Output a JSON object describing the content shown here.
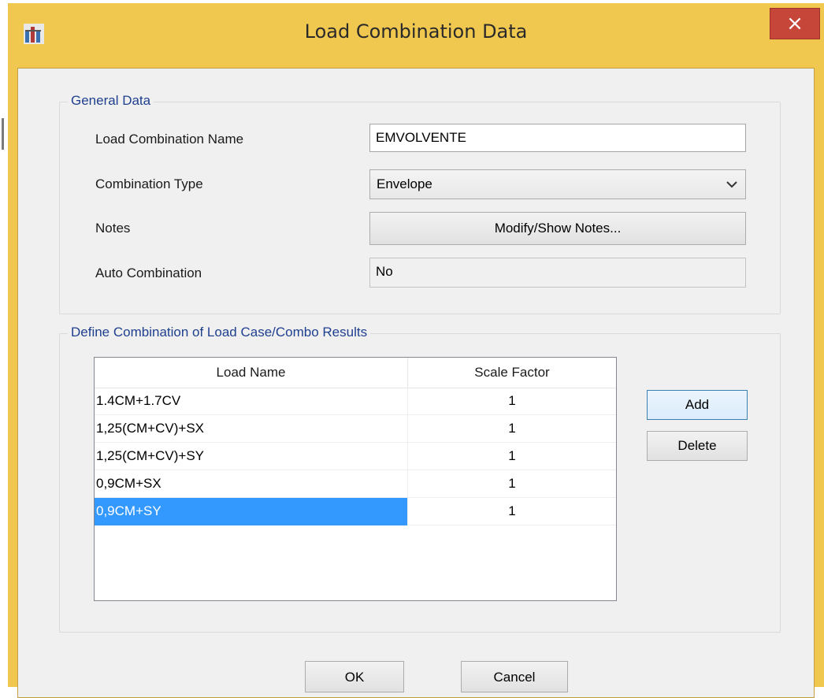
{
  "window": {
    "title": "Load Combination Data",
    "close_symbol": "×"
  },
  "general": {
    "legend": "General Data",
    "name_label": "Load Combination Name",
    "name_value": "EMVOLVENTE",
    "type_label": "Combination Type",
    "type_value": "Envelope",
    "notes_label": "Notes",
    "notes_button": "Modify/Show Notes...",
    "auto_label": "Auto Combination",
    "auto_value": "No"
  },
  "combo": {
    "legend": "Define Combination of Load Case/Combo Results",
    "headers": [
      "Load Name",
      "Scale Factor"
    ],
    "rows": [
      {
        "name": "1.4CM+1.7CV",
        "factor": "1"
      },
      {
        "name": "1,25(CM+CV)+SX",
        "factor": "1"
      },
      {
        "name": "1,25(CM+CV)+SY",
        "factor": "1"
      },
      {
        "name": "0,9CM+SX",
        "factor": "1"
      },
      {
        "name": "0,9CM+SY",
        "factor": "1"
      }
    ],
    "selected_row_index": 4,
    "add_button": "Add",
    "delete_button": "Delete"
  },
  "footer": {
    "ok_button": "OK",
    "cancel_button": "Cancel"
  },
  "colors": {
    "frame": "#f0c850",
    "close": "#c7463a",
    "legend_text": "#1f3f8f",
    "selection": "#3399ff"
  },
  "icons": {
    "app": "app-icon",
    "close": "close-icon",
    "dropdown": "chevron-down-icon"
  }
}
